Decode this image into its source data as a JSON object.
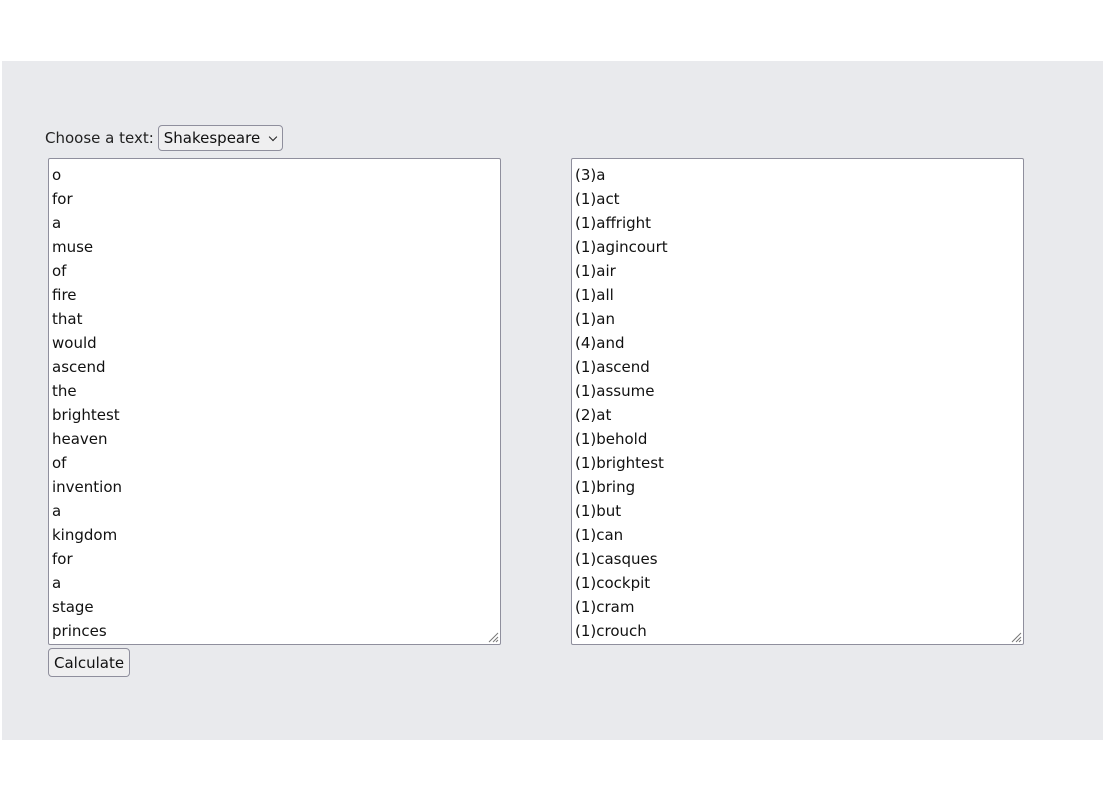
{
  "chooser": {
    "label": "Choose a text:",
    "selected": "Shakespeare"
  },
  "input_words": [
    "o",
    "for",
    "a",
    "muse",
    "of",
    "fire",
    "that",
    "would",
    "ascend",
    "the",
    "brightest",
    "heaven",
    "of",
    "invention",
    "a",
    "kingdom",
    "for",
    "a",
    "stage",
    "princes"
  ],
  "output_counts": [
    "(3)a",
    "(1)act",
    "(1)affright",
    "(1)agincourt",
    "(1)air",
    "(1)all",
    "(1)an",
    "(4)and",
    "(1)ascend",
    "(1)assume",
    "(2)at",
    "(1)behold",
    "(1)brightest",
    "(1)bring",
    "(1)but",
    "(1)can",
    "(1)casques",
    "(1)cockpit",
    "(1)cram",
    "(1)crouch"
  ],
  "calculate_label": "Calculate",
  "icons": {
    "dropdown": "chevron-down-icon",
    "resize": "resize-grip-icon"
  }
}
